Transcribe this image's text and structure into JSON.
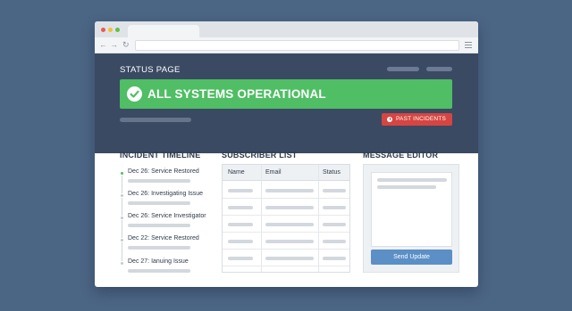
{
  "header": {
    "title": "STATUS PAGE",
    "status_banner": "ALL SYSTEMS OPERATIONAL",
    "status_icon": "check-circle-icon",
    "past_incidents_label": "PAST INCIDENTS",
    "past_incidents_icon": "clock-icon"
  },
  "timeline": {
    "heading": "INCIDENT TIMELINE",
    "items": [
      {
        "label": "Dec 26: Service Restored",
        "active": true
      },
      {
        "label": "Dec 26: Investigating Issue",
        "active": false
      },
      {
        "label": "Dec 26: Service Investigator",
        "active": false
      },
      {
        "label": "Dec 22: Service Restored",
        "active": false
      },
      {
        "label": "Dec 27: Ianuing Issue",
        "active": false
      }
    ]
  },
  "subscribers": {
    "heading": "SUBSCRIBER LIST",
    "columns": [
      "Name",
      "Email",
      "Status"
    ]
  },
  "editor": {
    "heading": "MESSAGE EDITOR",
    "send_label": "Send Update"
  },
  "colors": {
    "page_bg": "#4b6584",
    "header_bg": "#3a4a63",
    "operational": "#4fbe64",
    "danger": "#d64541",
    "primary": "#5b8fc6"
  }
}
